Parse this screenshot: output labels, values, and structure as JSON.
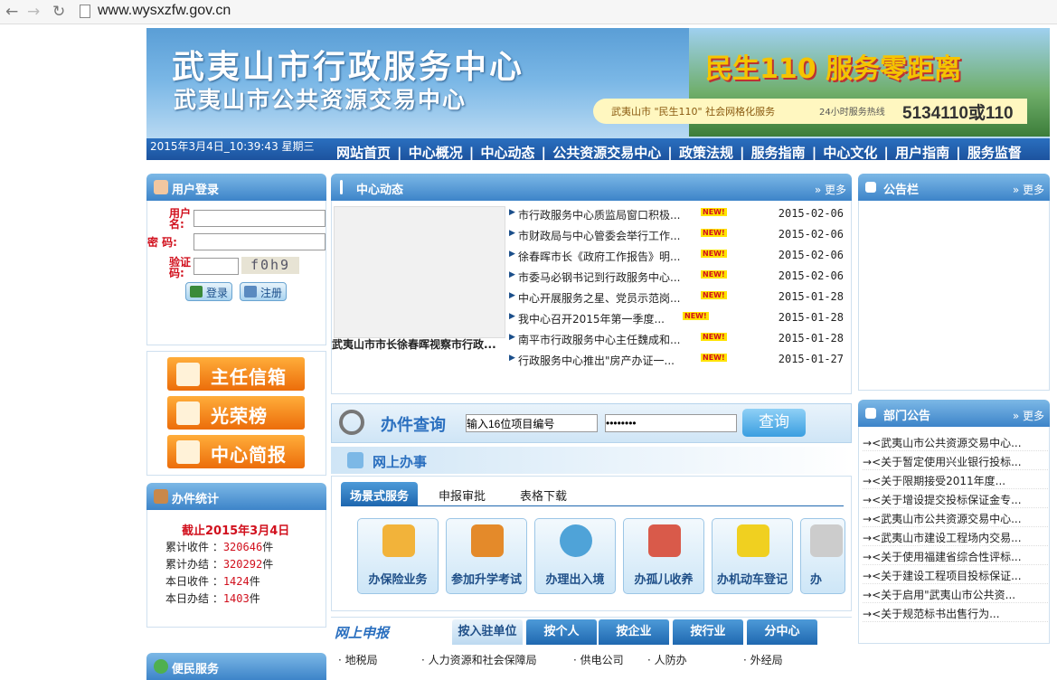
{
  "browser": {
    "url": "www.wysxzfw.gov.cn",
    "back_icon": "back-arrow-icon",
    "forward_icon": "forward-arrow-icon",
    "reload_icon": "reload-icon"
  },
  "banner": {
    "title": "武夷山市行政服务中心",
    "subtitle": "武夷山市公共资源交易中心",
    "slogan": "民生110  服务零距离",
    "band_left": "武夷山市 \"民生110\" 社会网格化服务",
    "band_mid": "24小时服务热线",
    "hotline": "5134110或110"
  },
  "navbar": {
    "date": "2015年3月4日_10:39:43 星期三",
    "items": [
      "网站首页",
      "中心概况",
      "中心动态",
      "公共资源交易中心",
      "政策法规",
      "服务指南",
      "中心文化",
      "用户指南",
      "服务监督"
    ]
  },
  "login": {
    "title": "用户登录",
    "user_label": "用户名:",
    "pass_label": "密  码:",
    "code_label": "验证码:",
    "captcha": "f0h9",
    "login_btn": "登录",
    "register_btn": "注册"
  },
  "quick_links": [
    "主任信箱",
    "光荣榜",
    "中心简报"
  ],
  "stats": {
    "title": "办件统计",
    "as_of": "截止2015年3月4日",
    "rows": [
      {
        "label": "累计收件 ：",
        "value": "320646",
        "unit": "件"
      },
      {
        "label": "累计办结 ：",
        "value": "320292",
        "unit": "件"
      },
      {
        "label": "本日收件 ：",
        "value": "1424",
        "unit": "件"
      },
      {
        "label": "本日办结 ：",
        "value": "1403",
        "unit": "件"
      }
    ]
  },
  "convenience": {
    "title": "便民服务"
  },
  "news": {
    "title": "中心动态",
    "more": "更多",
    "new_badge": "NEW!",
    "caption": "武夷山市市长徐春晖视察市行政...",
    "items": [
      {
        "title": "市行政服务中心质监局窗口积极...",
        "date": "2015-02-06"
      },
      {
        "title": "市财政局与中心管委会举行工作...",
        "date": "2015-02-06"
      },
      {
        "title": "徐春晖市长《政府工作报告》明...",
        "date": "2015-02-06"
      },
      {
        "title": "市委马必钢书记到行政服务中心...",
        "date": "2015-02-06"
      },
      {
        "title": "中心开展服务之星、党员示范岗...",
        "date": "2015-01-28"
      },
      {
        "title": "我中心召开2015年第一季度...",
        "date": "2015-01-28"
      },
      {
        "title": "南平市行政服务中心主任魏成和...",
        "date": "2015-01-28"
      },
      {
        "title": "行政服务中心推出\"房产办证一...",
        "date": "2015-01-27"
      }
    ]
  },
  "query": {
    "title": "办件查询",
    "code_value": "输入16位项目编号",
    "pass_value": "••••••••",
    "button": "查询"
  },
  "online": {
    "title": "网上办事",
    "tabs": [
      "场景式服务",
      "申报审批",
      "表格下载"
    ],
    "tiles": [
      "办保险业务",
      "参加升学考试",
      "办理出入境",
      "办孤儿收养",
      "办机动车登记",
      "办"
    ]
  },
  "declare": {
    "title": "网上申报",
    "tabs": [
      "按入驻单位",
      "按个人",
      "按企业",
      "按行业",
      "分中心"
    ],
    "row": [
      "地税局",
      "人力资源和社会保障局",
      "供电公司",
      "人防办",
      "外经局"
    ]
  },
  "notice": {
    "title": "公告栏",
    "more": "更多"
  },
  "dept": {
    "title": "部门公告",
    "more": "更多",
    "items": [
      "<武夷山市公共资源交易中心...",
      "<关于暂定使用兴业银行投标...",
      "<关于限期接受2011年度...",
      "<关于增设提交投标保证金专...",
      "<武夷山市公共资源交易中心...",
      "<武夷山市建设工程场内交易...",
      "<关于使用福建省综合性评标...",
      "<关于建设工程项目投标保证...",
      "<关于启用\"武夷山市公共资...",
      "<关于规范标书出售行为..."
    ]
  },
  "colors": {
    "accent_blue": "#2a6fbf",
    "red": "#d1101d",
    "orange": "#ec6d0a"
  }
}
